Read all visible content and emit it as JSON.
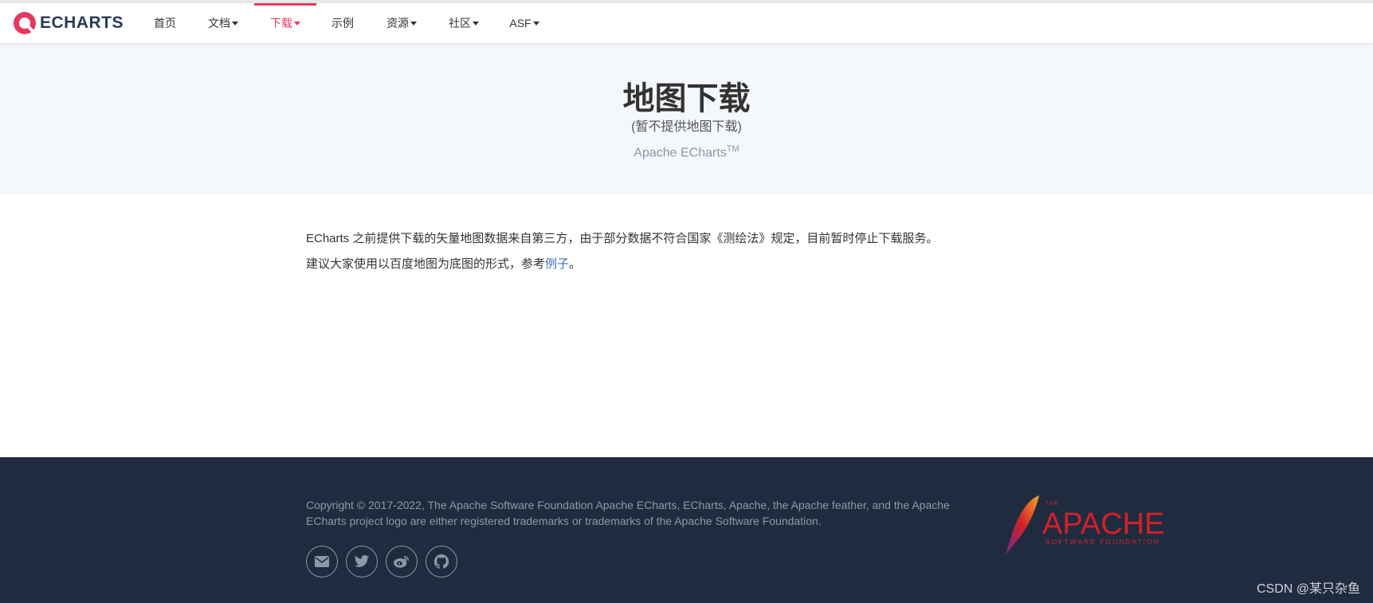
{
  "brand": {
    "logo_text": "ECHARTS"
  },
  "nav": {
    "items": [
      {
        "label": "首页",
        "dropdown": false,
        "active": false
      },
      {
        "label": "文档",
        "dropdown": true,
        "active": false
      },
      {
        "label": "下载",
        "dropdown": true,
        "active": true
      },
      {
        "label": "示例",
        "dropdown": false,
        "active": false
      },
      {
        "label": "资源",
        "dropdown": true,
        "active": false
      },
      {
        "label": "社区",
        "dropdown": true,
        "active": false
      },
      {
        "label": "ASF",
        "dropdown": true,
        "active": false
      }
    ]
  },
  "hero": {
    "title": "地图下载",
    "subtitle": "(暂不提供地图下载)",
    "brand": "Apache ECharts",
    "brand_tm": "TM"
  },
  "content": {
    "line1": "ECharts 之前提供下载的矢量地图数据来自第三方，由于部分数据不符合国家《测绘法》规定，目前暂时停止下载服务。",
    "line2_prefix": "建议大家使用以百度地图为底图的形式，参考",
    "line2_link": "例子",
    "line2_suffix": "。"
  },
  "footer": {
    "copyright": "Copyright © 2017-2022, The Apache Software Foundation Apache ECharts, ECharts, Apache, the Apache feather, and the Apache ECharts project logo are either registered trademarks or trademarks of the Apache Software Foundation.",
    "social_icons": [
      "mail-icon",
      "twitter-icon",
      "weibo-icon",
      "github-icon"
    ],
    "apache_logo": {
      "small": "THE",
      "name": "APACHE",
      "tagline": "SOFTWARE FOUNDATION"
    },
    "watermark": "CSDN @某只杂鱼"
  },
  "colors": {
    "accent": "#e43961",
    "hero_bg": "#f4f7fb",
    "footer_bg": "#202b3f",
    "link": "#3c6fb6",
    "logo_text": "#293c55"
  }
}
